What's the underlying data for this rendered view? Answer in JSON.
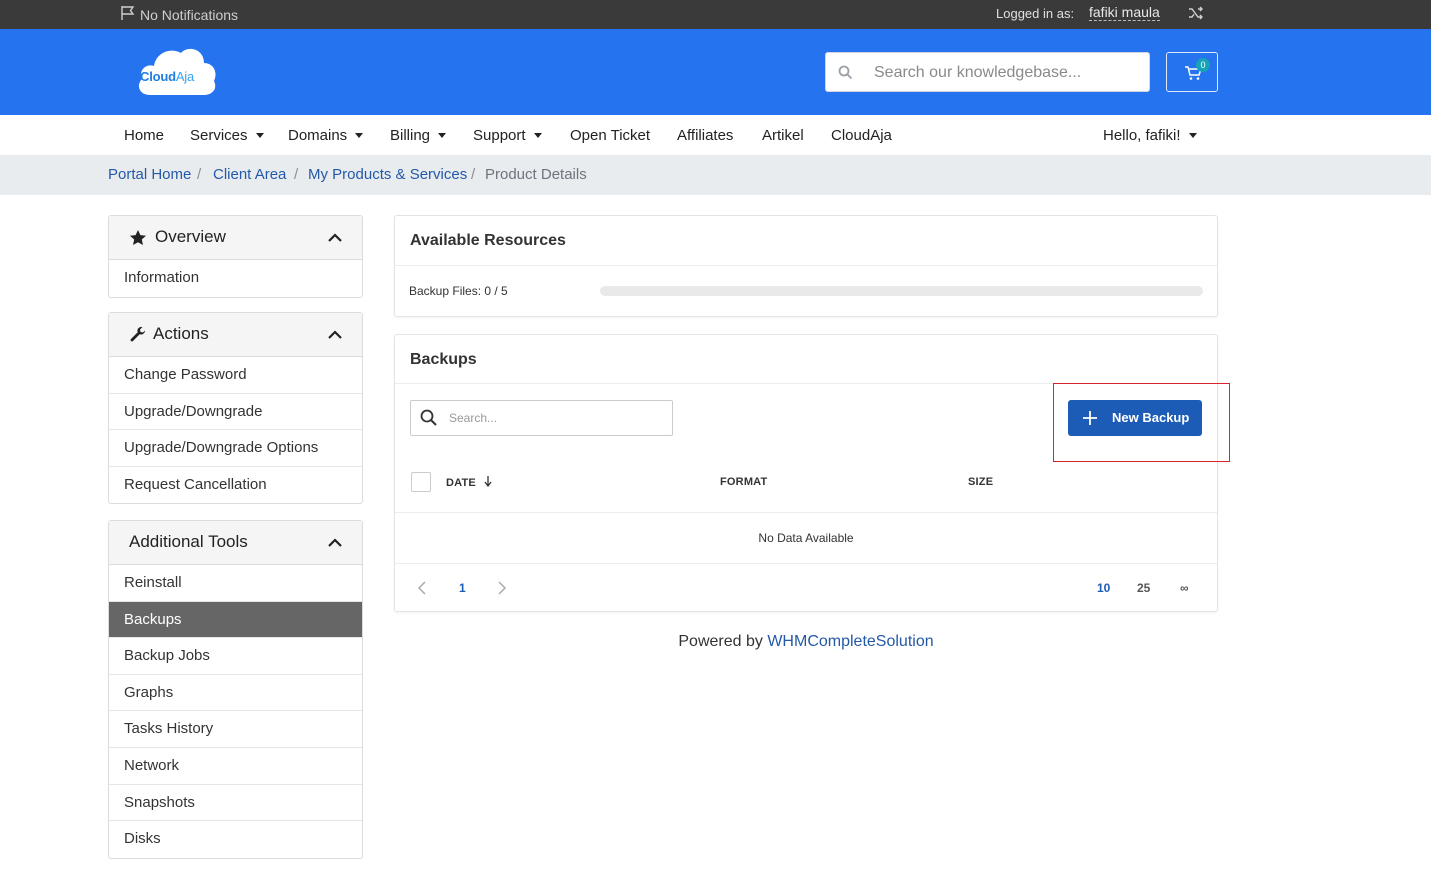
{
  "topbar": {
    "notifications": "No Notifications",
    "logged_in_label": "Logged in as:",
    "user_name": "fafiki maula"
  },
  "header": {
    "logo_text_primary": "Cloud",
    "logo_text_secondary": "Aja",
    "search_placeholder": "Search our knowledgebase...",
    "cart_count": "0",
    "brand_color": "#2673f0"
  },
  "nav": {
    "items": [
      {
        "label": "Home",
        "dropdown": false
      },
      {
        "label": "Services",
        "dropdown": true
      },
      {
        "label": "Domains",
        "dropdown": true
      },
      {
        "label": "Billing",
        "dropdown": true
      },
      {
        "label": "Support",
        "dropdown": true
      },
      {
        "label": "Open Ticket",
        "dropdown": false
      },
      {
        "label": "Affiliates",
        "dropdown": false
      },
      {
        "label": "Artikel",
        "dropdown": false
      },
      {
        "label": "CloudAja",
        "dropdown": false
      }
    ],
    "greeting": "Hello, fafiki!"
  },
  "breadcrumb": {
    "items": [
      "Portal Home",
      "Client Area",
      "My Products & Services",
      "Product Details"
    ],
    "separator": "/"
  },
  "sidebar": {
    "overview": {
      "title": "Overview",
      "icon": "star-icon",
      "items": [
        "Information"
      ]
    },
    "actions": {
      "title": "Actions",
      "icon": "wrench-icon",
      "items": [
        "Change Password",
        "Upgrade/Downgrade",
        "Upgrade/Downgrade Options",
        "Request Cancellation"
      ]
    },
    "tools": {
      "title": "Additional Tools",
      "items": [
        "Reinstall",
        "Backups",
        "Backup Jobs",
        "Graphs",
        "Tasks History",
        "Network",
        "Snapshots",
        "Disks"
      ],
      "active": "Backups"
    }
  },
  "resources": {
    "title": "Available Resources",
    "backup_files_label": "Backup Files: 0 / 5",
    "backup_files_used": 0,
    "backup_files_limit": 5
  },
  "backups": {
    "title": "Backups",
    "search_placeholder": "Search...",
    "new_button": "New Backup",
    "columns": [
      "DATE",
      "FORMAT",
      "SIZE"
    ],
    "sort_column": "DATE",
    "sort_direction": "desc",
    "empty_text": "No Data Available",
    "pagination": {
      "current_page": "1",
      "page_sizes": [
        "10",
        "25",
        "∞"
      ],
      "selected_size": "10"
    },
    "accent_color": "#1d5cb6"
  },
  "footer": {
    "prefix": "Powered by",
    "link": "WHMCompleteSolution"
  }
}
